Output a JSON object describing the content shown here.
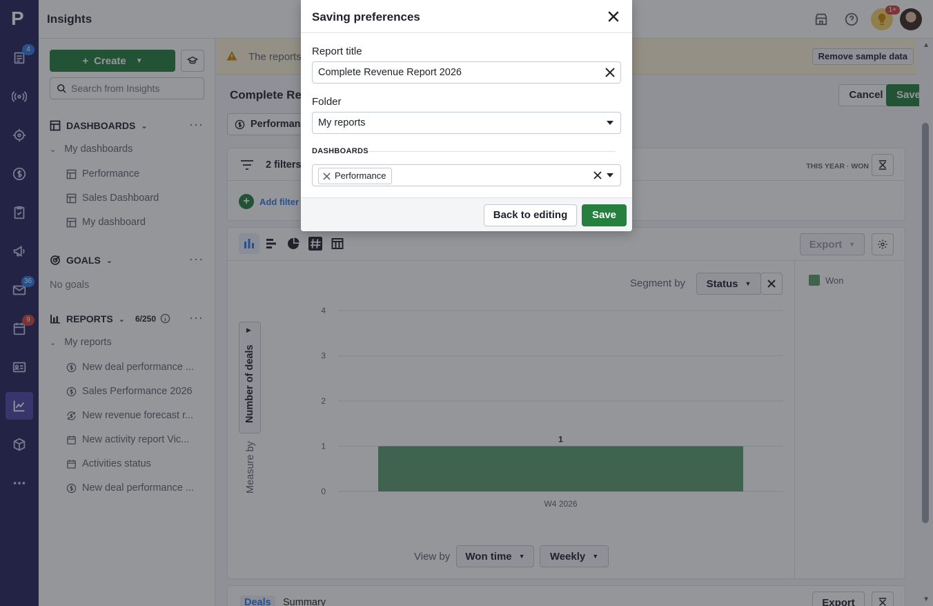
{
  "app": {
    "title": "Insights",
    "logo": "P"
  },
  "rail": {
    "items": [
      {
        "icon": "leads-icon",
        "badge": "4"
      },
      {
        "icon": "broadcast-icon"
      },
      {
        "icon": "target-icon"
      },
      {
        "icon": "deals-dollar-icon"
      },
      {
        "icon": "tasks-clipboard-icon"
      },
      {
        "icon": "campaigns-megaphone-icon"
      },
      {
        "icon": "mail-icon",
        "badge": "36"
      },
      {
        "icon": "calendar-icon",
        "badge": "9"
      },
      {
        "icon": "contacts-card-icon"
      },
      {
        "icon": "insights-chart-icon",
        "active": true
      },
      {
        "icon": "products-box-icon"
      },
      {
        "icon": "more-icon"
      }
    ]
  },
  "topbar": {
    "notification_badge": "1+"
  },
  "sidebar": {
    "create_label": "Create",
    "search_placeholder": "Search from Insights",
    "dashboards": {
      "heading": "DASHBOARDS",
      "group": "My dashboards",
      "items": [
        "Performance",
        "Sales Dashboard",
        "My dashboard"
      ]
    },
    "goals": {
      "heading": "GOALS",
      "empty": "No goals"
    },
    "reports": {
      "heading": "REPORTS",
      "count": "6/250",
      "group": "My reports",
      "items": [
        {
          "label": "New deal performance ...",
          "icon": "dollar-circle-icon"
        },
        {
          "label": "Sales Performance 2026",
          "icon": "dollar-circle-icon"
        },
        {
          "label": "New revenue forecast r...",
          "icon": "forecast-icon"
        },
        {
          "label": "New activity report Vic...",
          "icon": "calendar-icon"
        },
        {
          "label": "Activities status",
          "icon": "calendar-icon"
        },
        {
          "label": "New deal performance ...",
          "icon": "dollar-circle-icon"
        }
      ]
    }
  },
  "main": {
    "warning_text": "The reports",
    "remove_sample": "Remove sample data",
    "report_title": "Complete Rev",
    "cancel": "Cancel",
    "save": "Save",
    "performance_pill": "Performanc",
    "filters_label": "2 filters",
    "add_filter": "Add filter",
    "meta_tags": "THIS YEAR ·  WON",
    "export": "Export",
    "segment_by_label": "Segment by",
    "segment_value": "Status",
    "measure_by": "Measure by",
    "measure_value": "Number of deals",
    "view_by_label": "View by",
    "view_by_value": "Won time",
    "interval_value": "Weekly",
    "tabs": [
      "Deals",
      "Summary"
    ],
    "bottom_export": "Export"
  },
  "chart_data": {
    "type": "bar",
    "categories": [
      "W4 2026"
    ],
    "series": [
      {
        "name": "Won",
        "values": [
          1
        ],
        "color": "#5a9e6f"
      }
    ],
    "ylim": [
      0,
      4
    ],
    "yticks": [
      0,
      1,
      2,
      3,
      4
    ],
    "data_labels": [
      "1"
    ],
    "grid": true,
    "legend": "right"
  },
  "modal": {
    "title": "Saving preferences",
    "report_title_label": "Report title",
    "report_title_value": "Complete Revenue Report 2026",
    "folder_label": "Folder",
    "folder_value": "My reports",
    "dashboards_label": "DASHBOARDS",
    "dashboard_chip": "Performance",
    "back_button": "Back to editing",
    "save_button": "Save"
  }
}
